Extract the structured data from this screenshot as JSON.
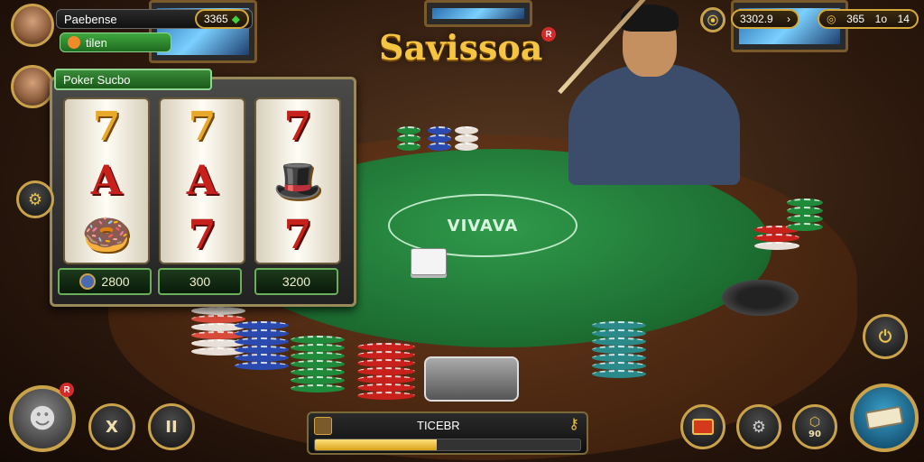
{
  "title": "Savissoa",
  "title_badge": "R",
  "players": [
    {
      "name": "Paebense",
      "sub": "tilen"
    },
    {
      "name": "Poker Sucbo"
    }
  ],
  "top_left_balance": "3365",
  "top_right": {
    "coins_icon": "coin-icon",
    "balance": "3302.9",
    "stat_value": "365",
    "stat_extra": "1o",
    "stat_extra2": "14"
  },
  "slot": {
    "header": "Poker Sucbo",
    "reels": [
      [
        "7",
        "A",
        "🍩",
        "🍔"
      ],
      [
        "7",
        "A",
        "7",
        "🎁"
      ],
      [
        "7",
        "🎩",
        "7",
        "🍪"
      ]
    ],
    "values": [
      "2800",
      "300",
      "3200"
    ]
  },
  "felt_logo": "VIVAVA",
  "bottom_left": {
    "badge": "R",
    "btn2": "X",
    "btn3": "II"
  },
  "progress": {
    "label": "TICEBR",
    "end_icon": "key-icon",
    "fraction": 0.46
  },
  "bottom_right": {
    "btn_extra_label": "90"
  },
  "colors": {
    "accent_gold": "#c9a24a",
    "felt_green": "#1c6b30",
    "title_gold": "#f5c542"
  }
}
